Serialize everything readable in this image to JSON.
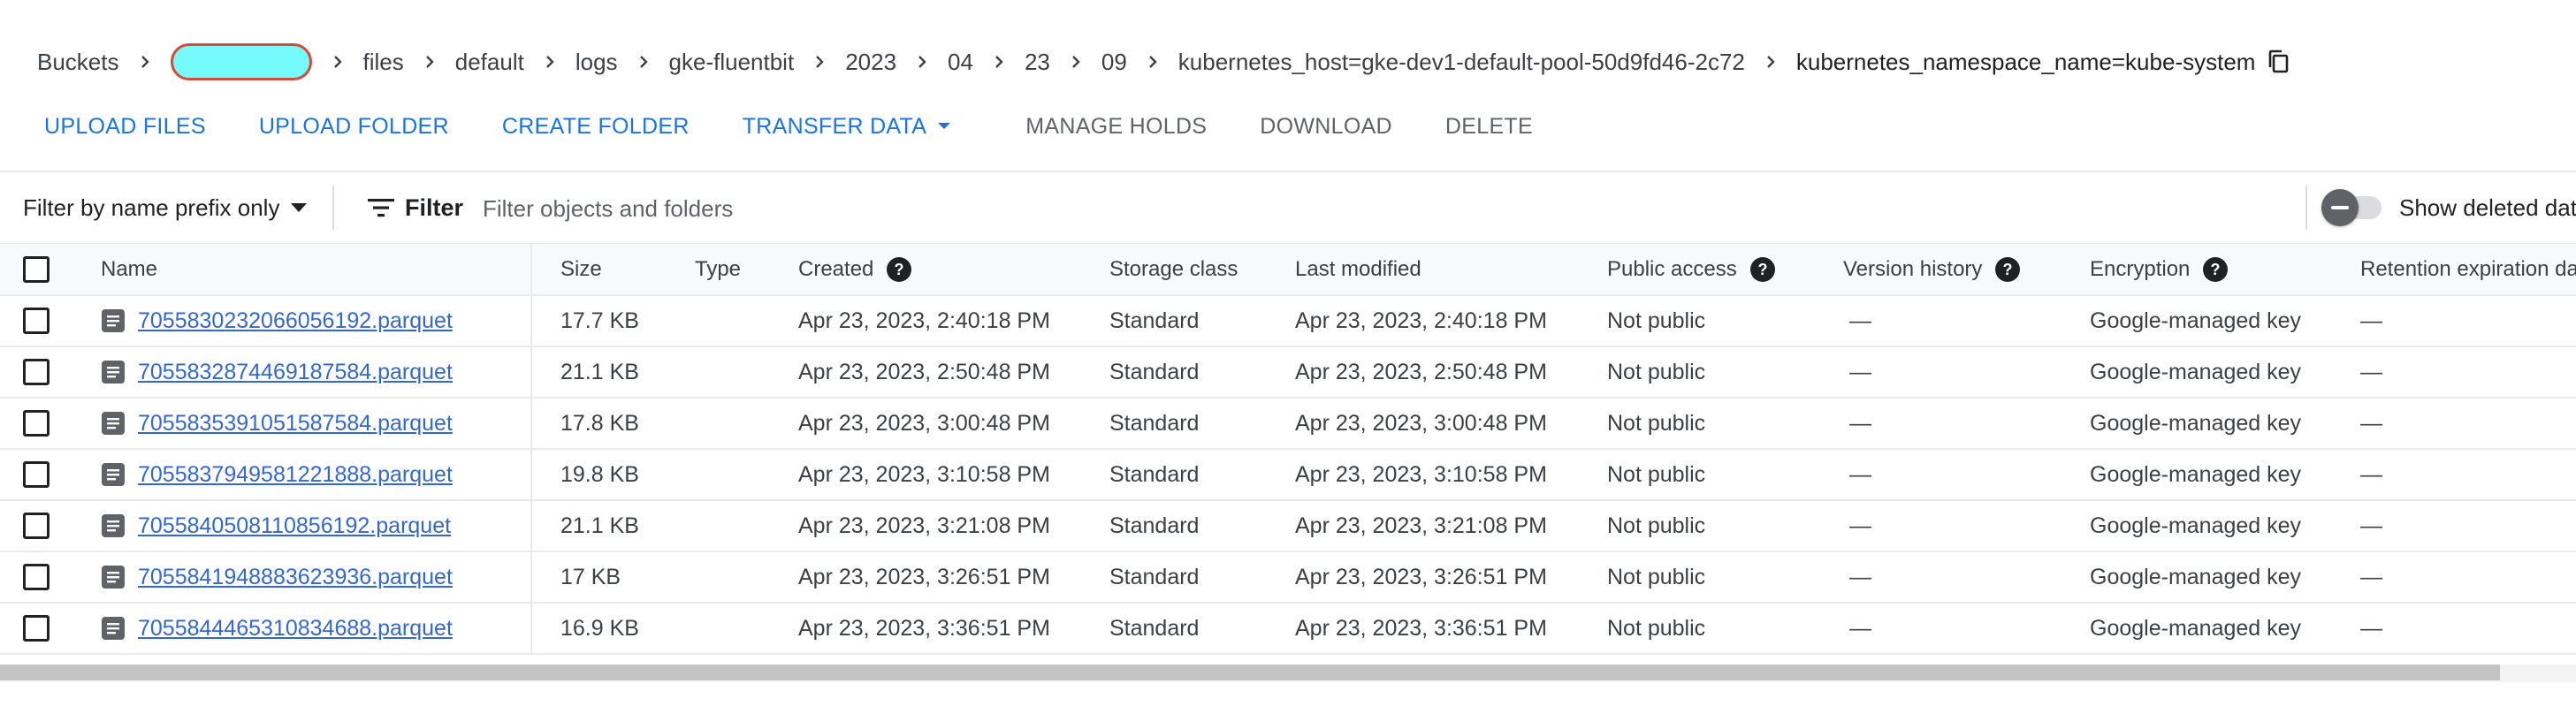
{
  "breadcrumb": {
    "items": [
      "Buckets",
      "files",
      "default",
      "logs",
      "gke-fluentbit",
      "2023",
      "04",
      "23",
      "09",
      "kubernetes_host=gke-dev1-default-pool-50d9fd46-2c72",
      "kubernetes_namespace_name=kube-system"
    ],
    "redacted_color": "#76fbfd"
  },
  "actions": {
    "upload_files": "UPLOAD FILES",
    "upload_folder": "UPLOAD FOLDER",
    "create_folder": "CREATE FOLDER",
    "transfer_data": "TRANSFER DATA",
    "manage_holds": "MANAGE HOLDS",
    "download": "DOWNLOAD",
    "delete": "DELETE"
  },
  "filter": {
    "prefix_mode": "Filter by name prefix only",
    "button_label": "Filter",
    "placeholder": "Filter objects and folders",
    "show_deleted_label": "Show deleted data"
  },
  "table": {
    "columns": {
      "name": "Name",
      "size": "Size",
      "type": "Type",
      "created": "Created",
      "storage_class": "Storage class",
      "last_modified": "Last modified",
      "public_access": "Public access",
      "version_history": "Version history",
      "encryption": "Encryption",
      "retention": "Retention expiration date"
    },
    "rows": [
      {
        "name": "7055830232066056192.parquet",
        "size": "17.7 KB",
        "type": "",
        "created": "Apr 23, 2023, 2:40:18 PM",
        "storage_class": "Standard",
        "last_modified": "Apr 23, 2023, 2:40:18 PM",
        "public_access": "Not public",
        "version_history": "—",
        "encryption": "Google-managed key",
        "retention": "—"
      },
      {
        "name": "7055832874469187584.parquet",
        "size": "21.1 KB",
        "type": "",
        "created": "Apr 23, 2023, 2:50:48 PM",
        "storage_class": "Standard",
        "last_modified": "Apr 23, 2023, 2:50:48 PM",
        "public_access": "Not public",
        "version_history": "—",
        "encryption": "Google-managed key",
        "retention": "—"
      },
      {
        "name": "7055835391051587584.parquet",
        "size": "17.8 KB",
        "type": "",
        "created": "Apr 23, 2023, 3:00:48 PM",
        "storage_class": "Standard",
        "last_modified": "Apr 23, 2023, 3:00:48 PM",
        "public_access": "Not public",
        "version_history": "—",
        "encryption": "Google-managed key",
        "retention": "—"
      },
      {
        "name": "7055837949581221888.parquet",
        "size": "19.8 KB",
        "type": "",
        "created": "Apr 23, 2023, 3:10:58 PM",
        "storage_class": "Standard",
        "last_modified": "Apr 23, 2023, 3:10:58 PM",
        "public_access": "Not public",
        "version_history": "—",
        "encryption": "Google-managed key",
        "retention": "—"
      },
      {
        "name": "7055840508110856192.parquet",
        "size": "21.1 KB",
        "type": "",
        "created": "Apr 23, 2023, 3:21:08 PM",
        "storage_class": "Standard",
        "last_modified": "Apr 23, 2023, 3:21:08 PM",
        "public_access": "Not public",
        "version_history": "—",
        "encryption": "Google-managed key",
        "retention": "—"
      },
      {
        "name": "7055841948883623936.parquet",
        "size": "17 KB",
        "type": "",
        "created": "Apr 23, 2023, 3:26:51 PM",
        "storage_class": "Standard",
        "last_modified": "Apr 23, 2023, 3:26:51 PM",
        "public_access": "Not public",
        "version_history": "—",
        "encryption": "Google-managed key",
        "retention": "—"
      },
      {
        "name": "7055844465310834688.parquet",
        "size": "16.9 KB",
        "type": "",
        "created": "Apr 23, 2023, 3:36:51 PM",
        "storage_class": "Standard",
        "last_modified": "Apr 23, 2023, 3:36:51 PM",
        "public_access": "Not public",
        "version_history": "—",
        "encryption": "Google-managed key",
        "retention": "—"
      }
    ]
  },
  "icons": {
    "chevron": "chevron-right-icon",
    "copy": "copy-icon",
    "file": "file-icon",
    "help": "help-icon",
    "filter": "filter-icon"
  },
  "colors": {
    "primary": "#1a73e8",
    "link": "#3367d6",
    "header_bg": "#f8f9fa"
  }
}
